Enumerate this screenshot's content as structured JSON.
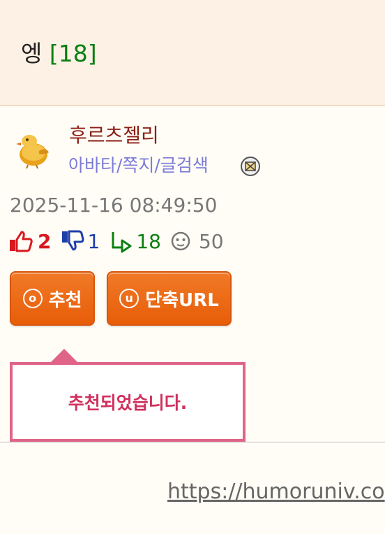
{
  "header": {
    "title": "엥",
    "reply_count": "[18]"
  },
  "author": {
    "nickname": "후르츠젤리",
    "links": "아바타/쪽지/글검색",
    "avatar_icon": "chick-avatar-icon",
    "mail_icon": "envelope-icon"
  },
  "post": {
    "datetime": "2025-11-16 08:49:50"
  },
  "stats": {
    "upvotes": "2",
    "downvotes": "1",
    "replies": "18",
    "views": "50"
  },
  "buttons": {
    "recommend_icon": "ⓞ",
    "recommend": "추천",
    "short_url_icon": "ⓤ",
    "short_url": "단축URL"
  },
  "tooltip": {
    "message": "추천되었습니다."
  },
  "footer": {
    "url": "https://humoruniv.co"
  },
  "colors": {
    "header_bg": "#fcf1e4",
    "accent_orange": "#e85d08",
    "tooltip_pink": "#e06487",
    "count_green": "#0b7f12"
  }
}
